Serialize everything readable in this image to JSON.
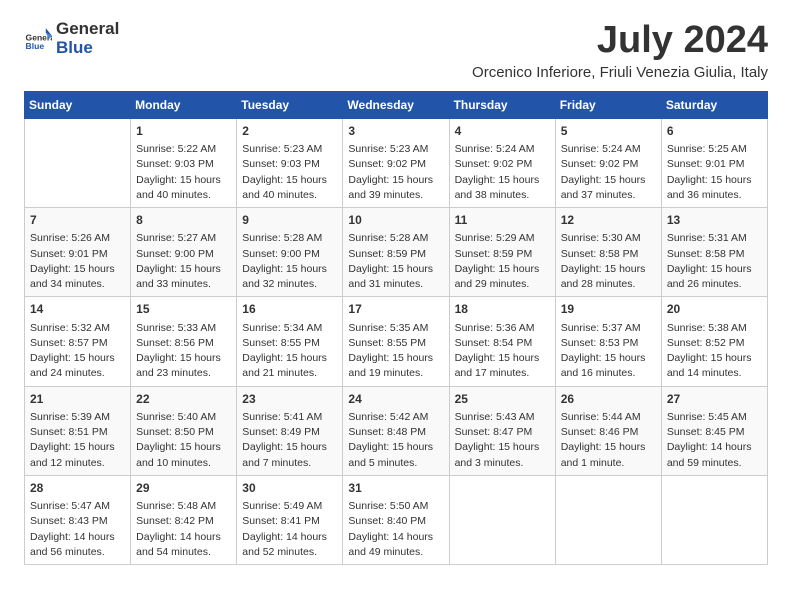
{
  "header": {
    "logo_general": "General",
    "logo_blue": "Blue",
    "month_title": "July 2024",
    "location": "Orcenico Inferiore, Friuli Venezia Giulia, Italy"
  },
  "days_of_week": [
    "Sunday",
    "Monday",
    "Tuesday",
    "Wednesday",
    "Thursday",
    "Friday",
    "Saturday"
  ],
  "weeks": [
    [
      {
        "day": "",
        "sunrise": "",
        "sunset": "",
        "daylight": ""
      },
      {
        "day": "1",
        "sunrise": "Sunrise: 5:22 AM",
        "sunset": "Sunset: 9:03 PM",
        "daylight": "Daylight: 15 hours and 40 minutes."
      },
      {
        "day": "2",
        "sunrise": "Sunrise: 5:23 AM",
        "sunset": "Sunset: 9:03 PM",
        "daylight": "Daylight: 15 hours and 40 minutes."
      },
      {
        "day": "3",
        "sunrise": "Sunrise: 5:23 AM",
        "sunset": "Sunset: 9:02 PM",
        "daylight": "Daylight: 15 hours and 39 minutes."
      },
      {
        "day": "4",
        "sunrise": "Sunrise: 5:24 AM",
        "sunset": "Sunset: 9:02 PM",
        "daylight": "Daylight: 15 hours and 38 minutes."
      },
      {
        "day": "5",
        "sunrise": "Sunrise: 5:24 AM",
        "sunset": "Sunset: 9:02 PM",
        "daylight": "Daylight: 15 hours and 37 minutes."
      },
      {
        "day": "6",
        "sunrise": "Sunrise: 5:25 AM",
        "sunset": "Sunset: 9:01 PM",
        "daylight": "Daylight: 15 hours and 36 minutes."
      }
    ],
    [
      {
        "day": "7",
        "sunrise": "Sunrise: 5:26 AM",
        "sunset": "Sunset: 9:01 PM",
        "daylight": "Daylight: 15 hours and 34 minutes."
      },
      {
        "day": "8",
        "sunrise": "Sunrise: 5:27 AM",
        "sunset": "Sunset: 9:00 PM",
        "daylight": "Daylight: 15 hours and 33 minutes."
      },
      {
        "day": "9",
        "sunrise": "Sunrise: 5:28 AM",
        "sunset": "Sunset: 9:00 PM",
        "daylight": "Daylight: 15 hours and 32 minutes."
      },
      {
        "day": "10",
        "sunrise": "Sunrise: 5:28 AM",
        "sunset": "Sunset: 8:59 PM",
        "daylight": "Daylight: 15 hours and 31 minutes."
      },
      {
        "day": "11",
        "sunrise": "Sunrise: 5:29 AM",
        "sunset": "Sunset: 8:59 PM",
        "daylight": "Daylight: 15 hours and 29 minutes."
      },
      {
        "day": "12",
        "sunrise": "Sunrise: 5:30 AM",
        "sunset": "Sunset: 8:58 PM",
        "daylight": "Daylight: 15 hours and 28 minutes."
      },
      {
        "day": "13",
        "sunrise": "Sunrise: 5:31 AM",
        "sunset": "Sunset: 8:58 PM",
        "daylight": "Daylight: 15 hours and 26 minutes."
      }
    ],
    [
      {
        "day": "14",
        "sunrise": "Sunrise: 5:32 AM",
        "sunset": "Sunset: 8:57 PM",
        "daylight": "Daylight: 15 hours and 24 minutes."
      },
      {
        "day": "15",
        "sunrise": "Sunrise: 5:33 AM",
        "sunset": "Sunset: 8:56 PM",
        "daylight": "Daylight: 15 hours and 23 minutes."
      },
      {
        "day": "16",
        "sunrise": "Sunrise: 5:34 AM",
        "sunset": "Sunset: 8:55 PM",
        "daylight": "Daylight: 15 hours and 21 minutes."
      },
      {
        "day": "17",
        "sunrise": "Sunrise: 5:35 AM",
        "sunset": "Sunset: 8:55 PM",
        "daylight": "Daylight: 15 hours and 19 minutes."
      },
      {
        "day": "18",
        "sunrise": "Sunrise: 5:36 AM",
        "sunset": "Sunset: 8:54 PM",
        "daylight": "Daylight: 15 hours and 17 minutes."
      },
      {
        "day": "19",
        "sunrise": "Sunrise: 5:37 AM",
        "sunset": "Sunset: 8:53 PM",
        "daylight": "Daylight: 15 hours and 16 minutes."
      },
      {
        "day": "20",
        "sunrise": "Sunrise: 5:38 AM",
        "sunset": "Sunset: 8:52 PM",
        "daylight": "Daylight: 15 hours and 14 minutes."
      }
    ],
    [
      {
        "day": "21",
        "sunrise": "Sunrise: 5:39 AM",
        "sunset": "Sunset: 8:51 PM",
        "daylight": "Daylight: 15 hours and 12 minutes."
      },
      {
        "day": "22",
        "sunrise": "Sunrise: 5:40 AM",
        "sunset": "Sunset: 8:50 PM",
        "daylight": "Daylight: 15 hours and 10 minutes."
      },
      {
        "day": "23",
        "sunrise": "Sunrise: 5:41 AM",
        "sunset": "Sunset: 8:49 PM",
        "daylight": "Daylight: 15 hours and 7 minutes."
      },
      {
        "day": "24",
        "sunrise": "Sunrise: 5:42 AM",
        "sunset": "Sunset: 8:48 PM",
        "daylight": "Daylight: 15 hours and 5 minutes."
      },
      {
        "day": "25",
        "sunrise": "Sunrise: 5:43 AM",
        "sunset": "Sunset: 8:47 PM",
        "daylight": "Daylight: 15 hours and 3 minutes."
      },
      {
        "day": "26",
        "sunrise": "Sunrise: 5:44 AM",
        "sunset": "Sunset: 8:46 PM",
        "daylight": "Daylight: 15 hours and 1 minute."
      },
      {
        "day": "27",
        "sunrise": "Sunrise: 5:45 AM",
        "sunset": "Sunset: 8:45 PM",
        "daylight": "Daylight: 14 hours and 59 minutes."
      }
    ],
    [
      {
        "day": "28",
        "sunrise": "Sunrise: 5:47 AM",
        "sunset": "Sunset: 8:43 PM",
        "daylight": "Daylight: 14 hours and 56 minutes."
      },
      {
        "day": "29",
        "sunrise": "Sunrise: 5:48 AM",
        "sunset": "Sunset: 8:42 PM",
        "daylight": "Daylight: 14 hours and 54 minutes."
      },
      {
        "day": "30",
        "sunrise": "Sunrise: 5:49 AM",
        "sunset": "Sunset: 8:41 PM",
        "daylight": "Daylight: 14 hours and 52 minutes."
      },
      {
        "day": "31",
        "sunrise": "Sunrise: 5:50 AM",
        "sunset": "Sunset: 8:40 PM",
        "daylight": "Daylight: 14 hours and 49 minutes."
      },
      {
        "day": "",
        "sunrise": "",
        "sunset": "",
        "daylight": ""
      },
      {
        "day": "",
        "sunrise": "",
        "sunset": "",
        "daylight": ""
      },
      {
        "day": "",
        "sunrise": "",
        "sunset": "",
        "daylight": ""
      }
    ]
  ]
}
